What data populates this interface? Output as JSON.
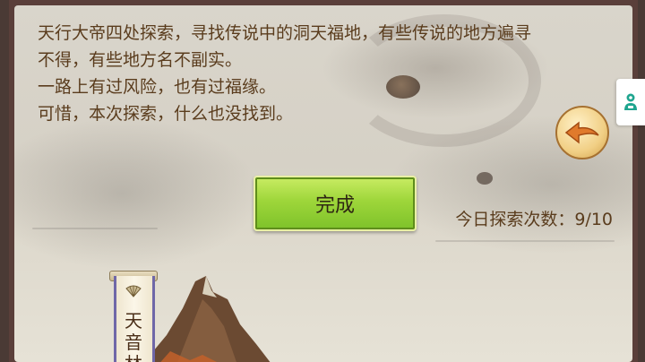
{
  "story": {
    "lines": [
      "天行大帝四处探索，寻找传说中的洞天福地，有些传说的地方遍寻",
      "不得，有些地方名不副实。",
      "一路上有过风险，也有过福缘。",
      "可惜，本次探索，什么也没找到。"
    ]
  },
  "actions": {
    "done_label": "完成"
  },
  "daily": {
    "count_text": "今日探索次数：9/10"
  },
  "location": {
    "name": "天音林"
  },
  "icons": {
    "back": "back-arrow-icon",
    "side": "game-center-icon",
    "fan": "fan-icon"
  },
  "colors": {
    "text": "#5a3c1d",
    "button_green": "#9ed63a",
    "back_button": "#f1cf85",
    "arrow": "#e07a2c"
  }
}
